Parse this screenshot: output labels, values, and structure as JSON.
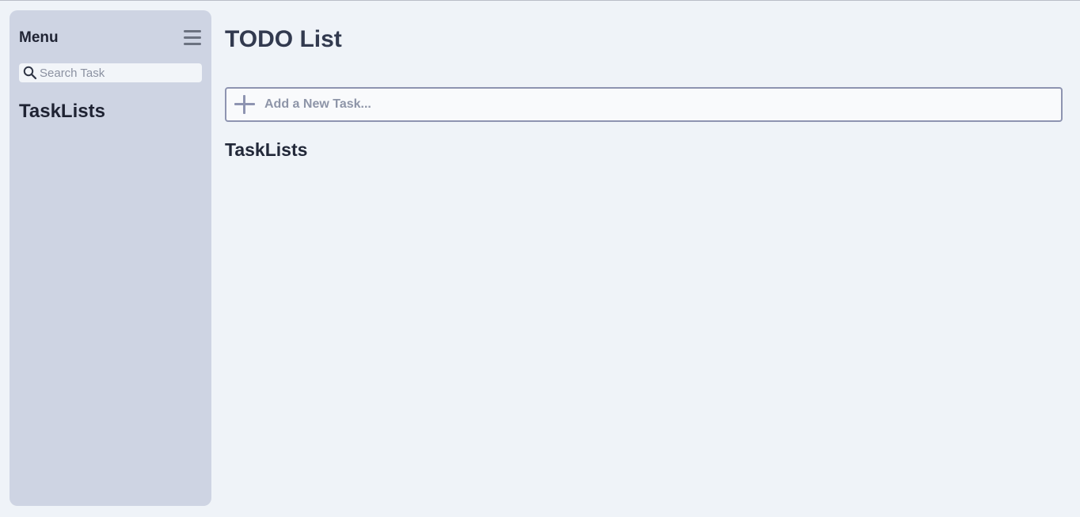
{
  "sidebar": {
    "title": "Menu",
    "toggle_icon": "hamburger-menu-icon",
    "search": {
      "icon": "search-icon",
      "placeholder": "Search Task",
      "value": ""
    },
    "section_title": "TaskLists"
  },
  "main": {
    "title": "TODO List",
    "add_task": {
      "icon": "plus-icon",
      "placeholder": "Add a New Task...",
      "value": ""
    },
    "section_title": "TaskLists"
  },
  "colors": {
    "background": "#eff3f8",
    "sidebar_background": "#ced4e3",
    "input_border": "#8e94b1",
    "heading_text": "#323a4f"
  }
}
